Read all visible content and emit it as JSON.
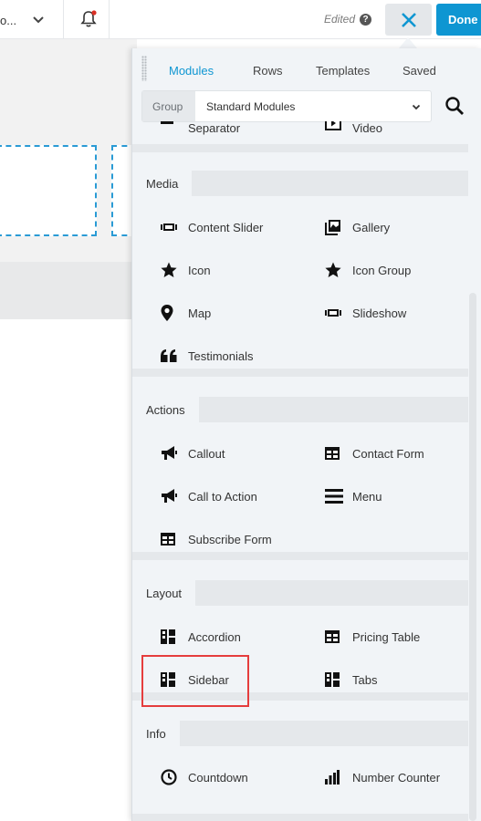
{
  "topbar": {
    "page_label": "o...",
    "edited_label": "Edited",
    "done_label": "Done"
  },
  "panel": {
    "tabs": [
      {
        "label": "Modules",
        "active": true
      },
      {
        "label": "Rows",
        "active": false
      },
      {
        "label": "Templates",
        "active": false
      },
      {
        "label": "Saved",
        "active": false
      }
    ],
    "group_label": "Group",
    "group_value": "Standard Modules"
  },
  "partial_items": [
    {
      "label": "Separator",
      "icon": "separator-icon"
    },
    {
      "label": "Video",
      "icon": "video-icon"
    }
  ],
  "sections": {
    "media": {
      "title": "Media",
      "items": [
        {
          "label": "Content Slider",
          "icon": "slider-icon"
        },
        {
          "label": "Gallery",
          "icon": "gallery-icon"
        },
        {
          "label": "Icon",
          "icon": "star-icon"
        },
        {
          "label": "Icon Group",
          "icon": "star-icon"
        },
        {
          "label": "Map",
          "icon": "map-marker-icon"
        },
        {
          "label": "Slideshow",
          "icon": "slider-icon"
        },
        {
          "label": "Testimonials",
          "icon": "quote-icon"
        }
      ]
    },
    "actions": {
      "title": "Actions",
      "items": [
        {
          "label": "Callout",
          "icon": "megaphone-icon"
        },
        {
          "label": "Contact Form",
          "icon": "table-icon"
        },
        {
          "label": "Call to Action",
          "icon": "megaphone-icon"
        },
        {
          "label": "Menu",
          "icon": "menu-icon"
        },
        {
          "label": "Subscribe Form",
          "icon": "table-icon"
        }
      ]
    },
    "layout": {
      "title": "Layout",
      "items": [
        {
          "label": "Accordion",
          "icon": "layout-icon"
        },
        {
          "label": "Pricing Table",
          "icon": "table-icon"
        },
        {
          "label": "Sidebar",
          "icon": "layout-icon"
        },
        {
          "label": "Tabs",
          "icon": "layout-icon"
        }
      ]
    },
    "info": {
      "title": "Info",
      "items": [
        {
          "label": "Countdown",
          "icon": "clock-icon"
        },
        {
          "label": "Number Counter",
          "icon": "bar-chart-icon"
        }
      ]
    }
  },
  "colors": {
    "accent": "#0e96d2",
    "highlight": "#e53d3d",
    "column_border": "#2a9bd5"
  }
}
